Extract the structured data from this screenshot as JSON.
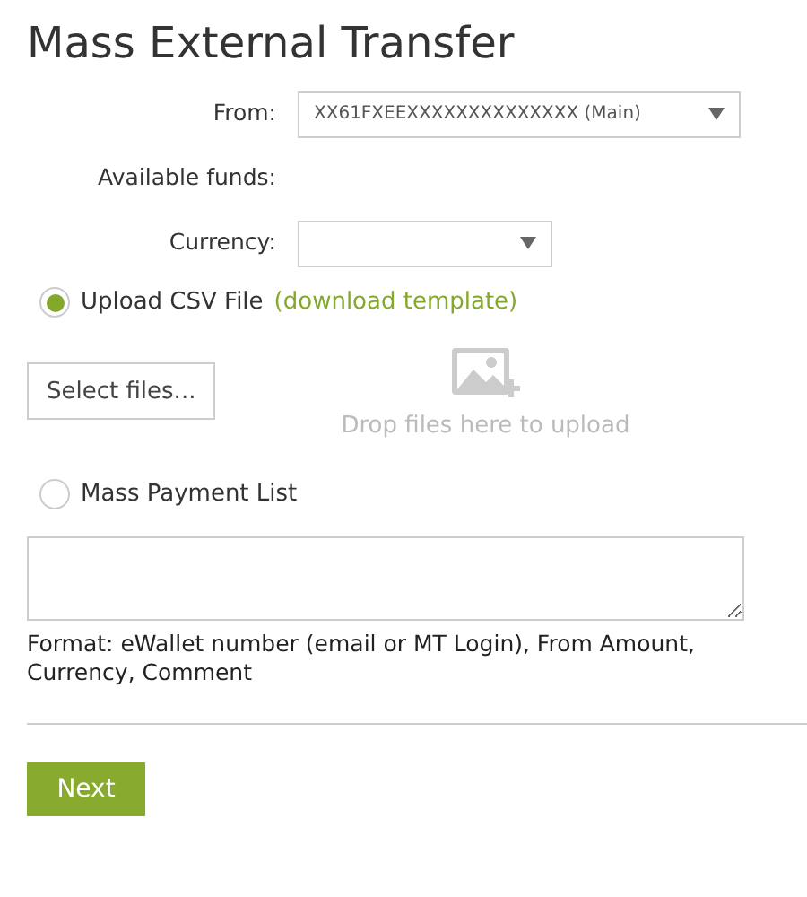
{
  "title": "Mass External Transfer",
  "fields": [
    {
      "kind": "select",
      "label": "From:",
      "value": "XX61FXEEXXXXXXXXXXXXXX (Main)"
    },
    {
      "kind": "text",
      "label": "Available funds:"
    },
    {
      "kind": "short-select",
      "label": "Currency:"
    }
  ],
  "options": [
    {
      "label": "Upload CSV File",
      "link": "(download template)",
      "selected": true
    },
    {
      "label": "Mass Payment List",
      "selected": false
    }
  ],
  "upload": {
    "button": "Select files...",
    "drop_hint": "Drop files here to upload"
  },
  "format_note": "Format: eWallet number (email or MT Login), From Amount, Currency, Comment",
  "next_button": "Next"
}
